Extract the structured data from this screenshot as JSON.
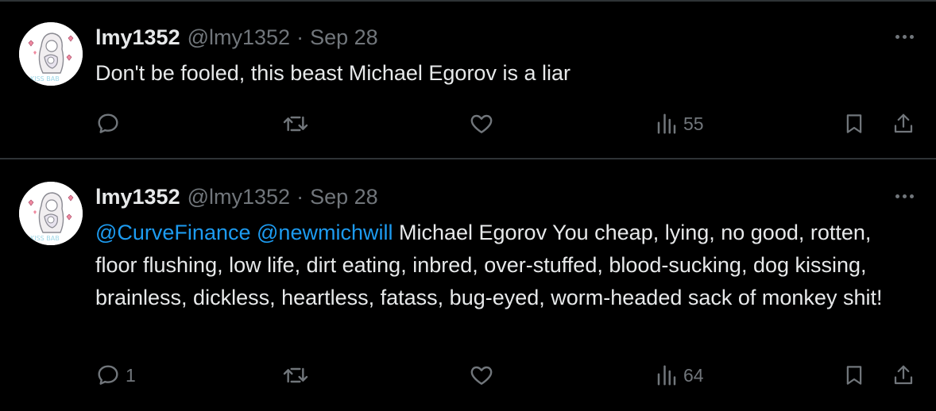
{
  "tweets": [
    {
      "display_name": "lmy1352",
      "handle": "@lmy1352",
      "separator": "·",
      "date": "Sep 28",
      "text": "Don't be fooled, this beast Michael Egorov is a liar",
      "mentions": [],
      "replies": "",
      "views": "55"
    },
    {
      "display_name": "lmy1352",
      "handle": "@lmy1352",
      "separator": "·",
      "date": "Sep 28",
      "mentions": [
        "@CurveFinance",
        "@newmichwill"
      ],
      "text": "Michael Egorov You cheap, lying, no good, rotten, floor flushing, low life,  dirt eating, inbred, over-stuffed, blood-sucking, dog kissing, brainless, dickless, heartless, fatass, bug-eyed, worm-headed sack of monkey shit!",
      "replies": "1",
      "views": "64"
    }
  ],
  "icons": {
    "reply": "reply-icon",
    "retweet": "retweet-icon",
    "like": "heart-icon",
    "views": "views-icon",
    "bookmark": "bookmark-icon",
    "share": "share-icon",
    "more": "more-icon"
  },
  "colors": {
    "background": "#000000",
    "text": "#e7e9ea",
    "muted": "#71767b",
    "link": "#1d9bf0",
    "divider": "#2f3336"
  }
}
